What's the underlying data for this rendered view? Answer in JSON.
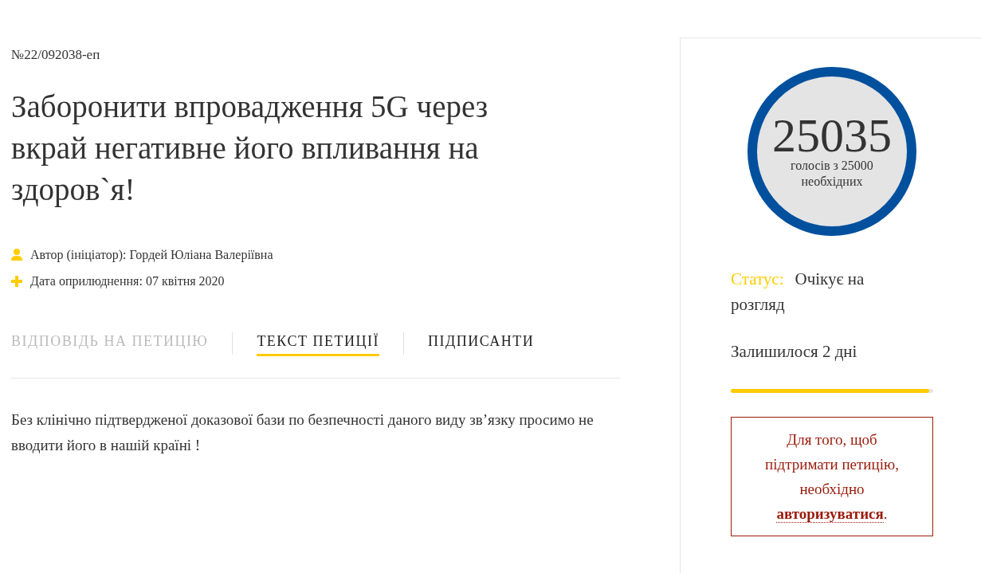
{
  "petition": {
    "number": "№22/092038-еп",
    "title": "Заборонити впровадження 5G через вкрай негативне його впливання на здоров`я!",
    "meta": [
      {
        "kind": "author",
        "text": "Автор (ініціатор): Гордей Юліана Валеріївна"
      },
      {
        "kind": "date",
        "text": "Дата оприлюднення: 07 квітня 2020"
      }
    ],
    "tabs": [
      {
        "label": "ВІДПОВІДЬ НА ПЕТИЦІЮ",
        "selected": false,
        "disabled": true
      },
      {
        "label": "ТЕКСТ ПЕТИЦІЇ",
        "selected": true,
        "disabled": false
      },
      {
        "label": "ПІДПИСАНТИ",
        "selected": false,
        "disabled": false
      }
    ],
    "body": "Без клінічно підтвердженої доказової бази по безпечності даного виду зв’язку просимо не вводити його в нашій країні !"
  },
  "sidebar": {
    "votes": "25035",
    "votes_caption": "голосів з 25000 необхідних",
    "status_label": "Статус:",
    "status_value": "Очікує на розгляд",
    "remaining": "Залишилося 2 дні",
    "progress": {
      "level": 0.98
    },
    "notice": {
      "text": "Для того, щоб підтримати петицію, необхідно",
      "link": "авторизуватися",
      "end": "."
    }
  }
}
